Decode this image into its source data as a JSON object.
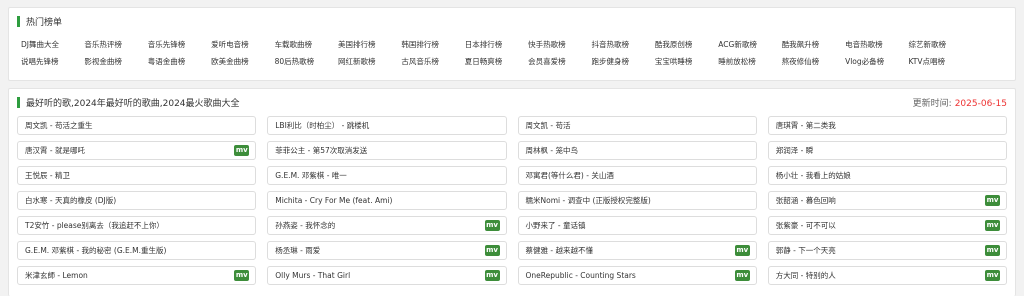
{
  "hot_section": {
    "title": "热门榜单",
    "categories": [
      "DJ舞曲大全",
      "音乐热评榜",
      "音乐先锋榜",
      "爱听电音榜",
      "车载歌曲榜",
      "美国排行榜",
      "韩国排行榜",
      "日本排行榜",
      "快手热歌榜",
      "抖音热歌榜",
      "酷我原创榜",
      "ACG新歌榜",
      "酷我飙升榜",
      "电音热歌榜",
      "综艺新歌榜",
      "说唱先锋榜",
      "影视金曲榜",
      "粤语金曲榜",
      "欧美金曲榜",
      "80后热歌榜",
      "网红新歌榜",
      "古风音乐榜",
      "夏日畅爽榜",
      "会员喜爱榜",
      "跑步健身榜",
      "宝宝哄睡榜",
      "睡前放松榜",
      "熬夜修仙榜",
      "Vlog必备榜",
      "KTV点唱榜"
    ]
  },
  "songs_section": {
    "title": "最好听的歌,2024年最好听的歌曲,2024最火歌曲大全",
    "update_label": "更新时间:",
    "update_date": "2025-06-15",
    "mv_label": "mv",
    "songs": [
      {
        "text": "周文凯 - 苟活之重生",
        "mv": false
      },
      {
        "text": "LBI利比（时柏尘） - 跳楼机",
        "mv": false
      },
      {
        "text": "周文凯 - 苟活",
        "mv": false
      },
      {
        "text": "唐琪霄 - 第二类我",
        "mv": false
      },
      {
        "text": "唐汉霄 - 就是哪吒",
        "mv": true
      },
      {
        "text": "菲菲公主 - 第57次取消发送",
        "mv": false
      },
      {
        "text": "周林枫 - 笼中鸟",
        "mv": false
      },
      {
        "text": "郑润泽 - 瞬",
        "mv": false
      },
      {
        "text": "王悦辰 - 精卫",
        "mv": false
      },
      {
        "text": "G.E.M. 邓紫棋 - 唯一",
        "mv": false
      },
      {
        "text": "邓寓君(等什么君) - 关山酒",
        "mv": false
      },
      {
        "text": "杨小壮 - 我看上的姑娘",
        "mv": false
      },
      {
        "text": "白水寒 - 天真的橡皮 (DJ版)",
        "mv": false
      },
      {
        "text": "Michita - Cry For Me (feat. Ami)",
        "mv": false
      },
      {
        "text": "糯米Nomi - 调查中 (正版授权完整版)",
        "mv": false
      },
      {
        "text": "张韶涵 - 暮色回响",
        "mv": true
      },
      {
        "text": "T2安竹 - please别离去（我追赶不上你）",
        "mv": false
      },
      {
        "text": "孙燕姿 - 我怀念的",
        "mv": true
      },
      {
        "text": "小野来了 - 童话镇",
        "mv": false
      },
      {
        "text": "张紫豪 - 可不可以",
        "mv": true
      },
      {
        "text": "G.E.M. 邓紫棋 - 我的秘密 (G.E.M.重生版)",
        "mv": false
      },
      {
        "text": "杨丞琳 - 雨爱",
        "mv": true
      },
      {
        "text": "蔡健雅 - 越来越不懂",
        "mv": true
      },
      {
        "text": "郭静 - 下一个天亮",
        "mv": true
      },
      {
        "text": "米津玄師 - Lemon",
        "mv": true
      },
      {
        "text": "Olly Murs - That Girl",
        "mv": true
      },
      {
        "text": "OneRepublic - Counting Stars",
        "mv": true
      },
      {
        "text": "方大同 - 特别的人",
        "mv": true
      }
    ]
  }
}
